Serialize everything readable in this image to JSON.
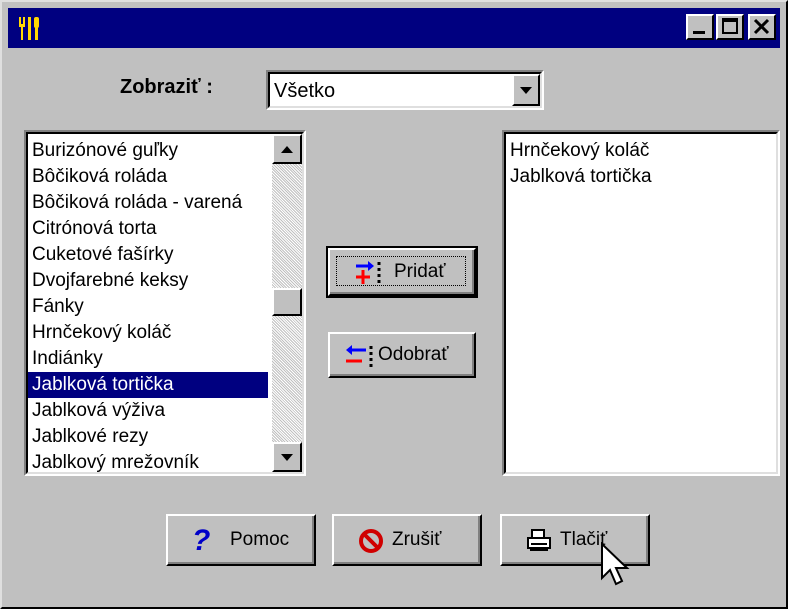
{
  "window": {
    "title": "",
    "app_icon": "fork-knife-icon",
    "controls": [
      "minimize-icon",
      "maximize-icon",
      "close-icon"
    ]
  },
  "filter": {
    "label": "Zobraziť :",
    "selected": "Všetko"
  },
  "available_list": {
    "items": [
      "Burizónové guľky",
      "Bôčiková roláda",
      "Bôčiková roláda - varená",
      "Citrónová torta",
      "Cuketové fašírky",
      "Dvojfarebné keksy",
      "Fánky",
      "Hrnčekový koláč",
      "Indiánky",
      "Jablková tortička",
      "Jablková výživa",
      "Jablkové rezy",
      "Jablkový mrežovník"
    ],
    "selected_index": 9
  },
  "selected_list": {
    "items": [
      "Hrnčekový koláč",
      "Jablková tortička"
    ]
  },
  "buttons": {
    "add": "Pridať",
    "remove": "Odobrať",
    "help": "Pomoc",
    "cancel": "Zrušiť",
    "print": "Tlačiť"
  },
  "colors": {
    "face": "#c0c0c0",
    "titlebar": "#000080",
    "selection": "#000080",
    "help_icon": "#0000c8",
    "cancel_icon": "#d00000",
    "arrow_blue": "#0000ff",
    "arrow_red": "#ff0000"
  }
}
